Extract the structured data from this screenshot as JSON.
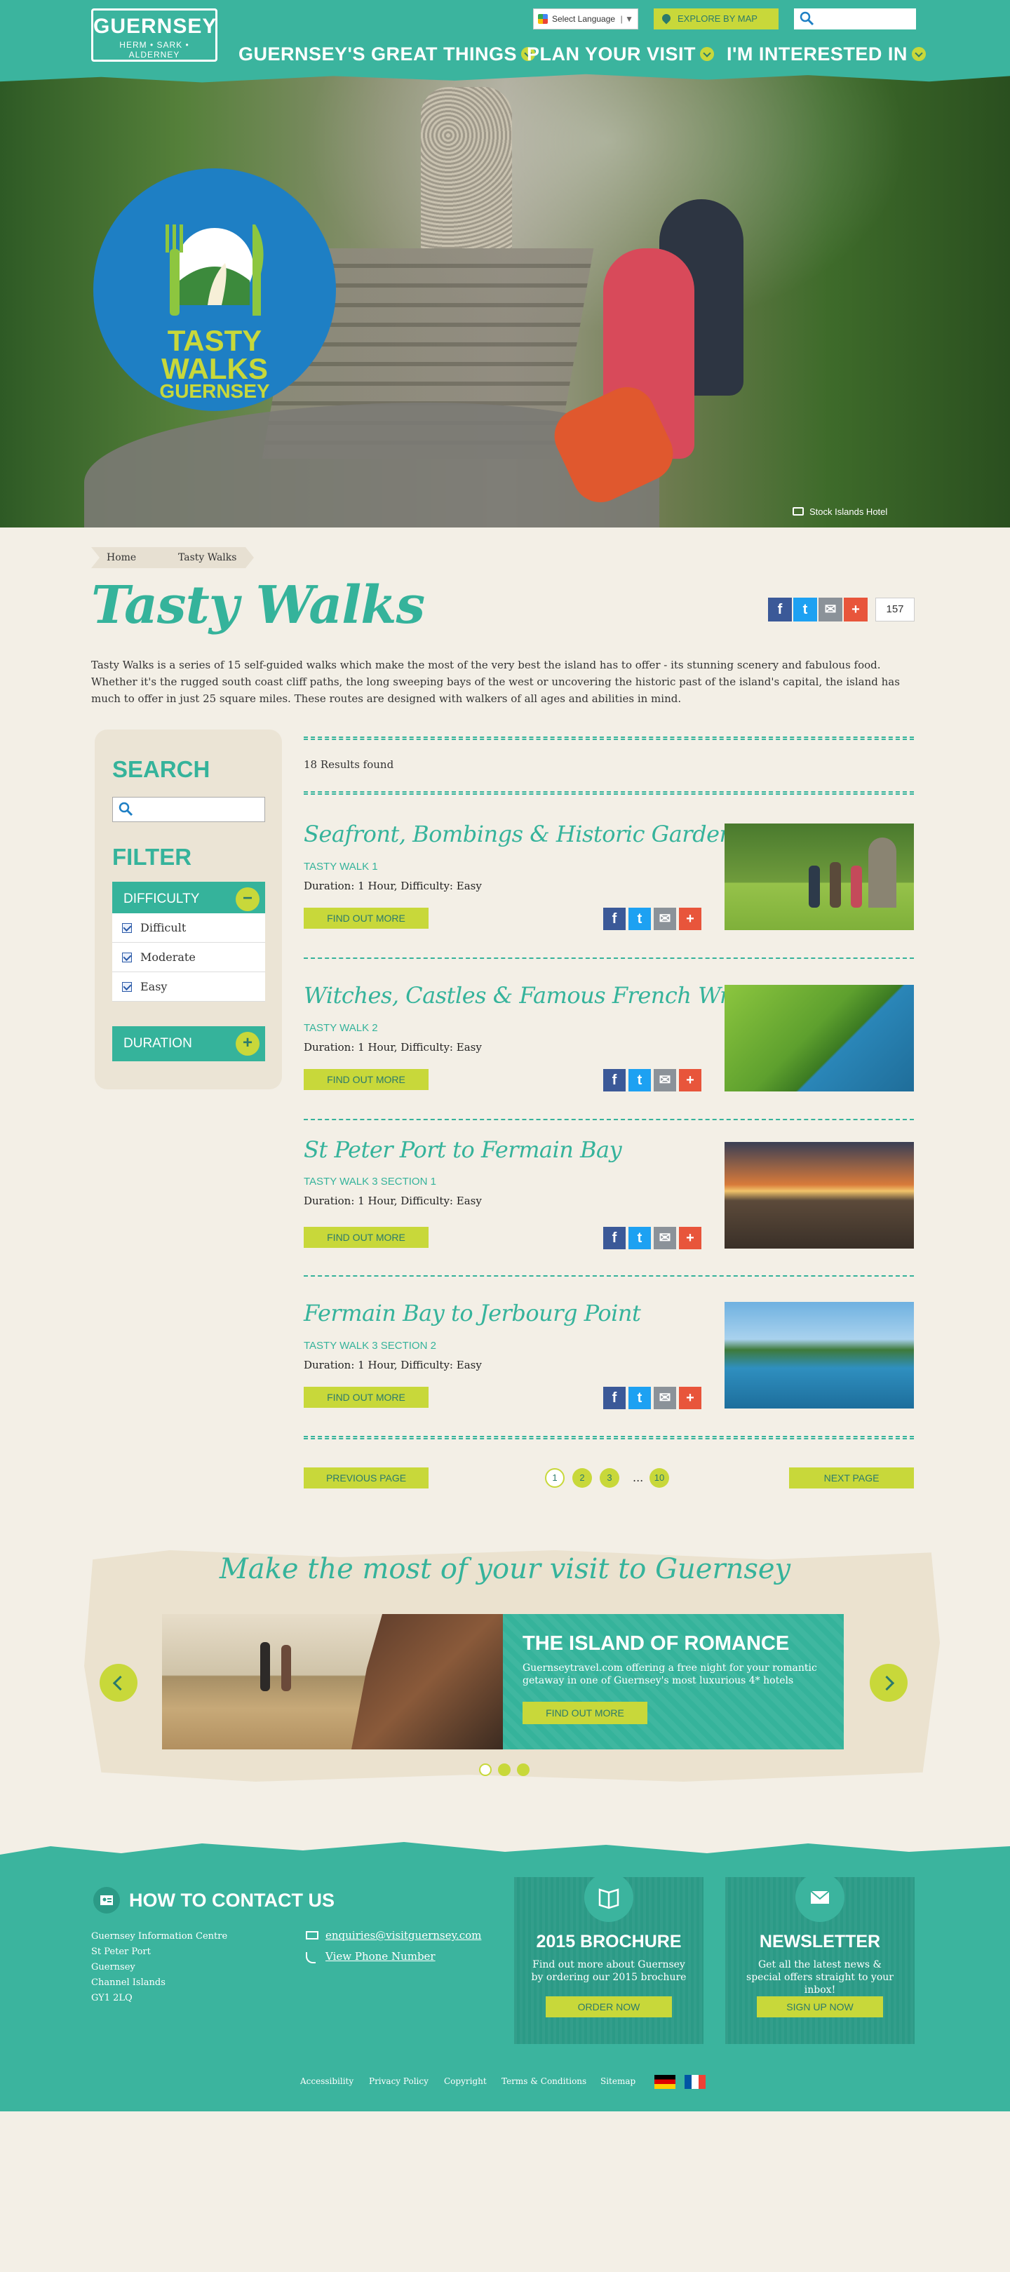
{
  "header": {
    "logo": {
      "name": "GUERNSEY",
      "tagline": "HERM • SARK • ALDERNEY"
    },
    "language_select": "Select Language",
    "explore_button": "EXPLORE BY MAP",
    "search_placeholder": "",
    "nav": [
      {
        "label": "GUERNSEY'S GREAT THINGS"
      },
      {
        "label": "PLAN YOUR VISIT"
      },
      {
        "label": "I'M INTERESTED IN"
      }
    ]
  },
  "hero": {
    "badge": {
      "line1": "TASTY",
      "line2": "WALKS",
      "line3": "GUERNSEY"
    },
    "photo_credit": "Stock Islands Hotel"
  },
  "breadcrumb": [
    "Home",
    "Tasty Walks"
  ],
  "page": {
    "title": "Tasty Walks",
    "share_count": "157",
    "intro_p1": "Tasty Walks is a series of 15 self-guided walks which make the most of the very best the island has to offer - its stunning scenery and fabulous food.",
    "intro_p2": "Whether it's the rugged south coast cliff paths, the long sweeping bays of the west or uncovering the historic past of the island's capital, the island has much to offer in just 25 square miles. These routes are designed with walkers of all ages and abilities in mind."
  },
  "sidebar": {
    "search_heading": "SEARCH",
    "search_placeholder": "",
    "filter_heading": "FILTER",
    "difficulty": {
      "label": "DIFFICULTY",
      "toggle": "−",
      "options": [
        "Difficult",
        "Moderate",
        "Easy"
      ]
    },
    "duration": {
      "label": "DURATION",
      "toggle": "+"
    }
  },
  "results": {
    "count": "18 Results found",
    "find_out_more": "FIND OUT MORE",
    "items": [
      {
        "title": "Seafront, Bombings & Historic Gardens",
        "subtitle": "TASTY WALK 1",
        "meta": "Duration: 1 Hour, Difficulty: Easy"
      },
      {
        "title": "Witches, Castles & Famous French Writers",
        "subtitle": "TASTY WALK 2",
        "meta": "Duration: 1 Hour, Difficulty: Easy"
      },
      {
        "title": "St Peter Port to Fermain Bay",
        "subtitle": "TASTY WALK 3 SECTION 1",
        "meta": "Duration: 1 Hour, Difficulty: Easy"
      },
      {
        "title": "Fermain Bay to Jerbourg Point",
        "subtitle": "TASTY WALK 3 SECTION 2",
        "meta": "Duration: 1 Hour, Difficulty: Easy"
      }
    ]
  },
  "pagination": {
    "prev": "PREVIOUS PAGE",
    "next": "NEXT PAGE",
    "pages": [
      "1",
      "2",
      "3",
      "10"
    ],
    "ellipsis": "...",
    "current": "1"
  },
  "promo": {
    "heading": "Make the most of your visit to Guernsey",
    "slide_title": "THE ISLAND OF ROMANCE",
    "slide_text": "Guernseytravel.com offering a free night for your romantic getaway in one of Guernsey's most luxurious 4* hotels",
    "slide_button": "FIND OUT MORE"
  },
  "footer": {
    "contact_heading": "HOW TO CONTACT US",
    "address": [
      "Guernsey Information Centre",
      "St Peter Port",
      "Guernsey",
      "Channel Islands",
      "GY1 2LQ"
    ],
    "email": "enquiries@visitguernsey.com",
    "phone": "View Phone Number",
    "brochure": {
      "title": "2015 BROCHURE",
      "text": "Find out more about Guernsey by ordering our 2015 brochure",
      "button": "ORDER NOW"
    },
    "newsletter": {
      "title": "NEWSLETTER",
      "text": "Get all the latest news & special offers straight to your inbox!",
      "button": "SIGN UP NOW"
    },
    "links": [
      "Accessibility",
      "Privacy Policy",
      "Copyright",
      "Terms & Conditions",
      "Sitemap"
    ]
  },
  "colors": {
    "teal": "#3bb49e",
    "lime": "#c8d83a",
    "cream": "#f3efe6",
    "blue": "#1e7fc4"
  }
}
